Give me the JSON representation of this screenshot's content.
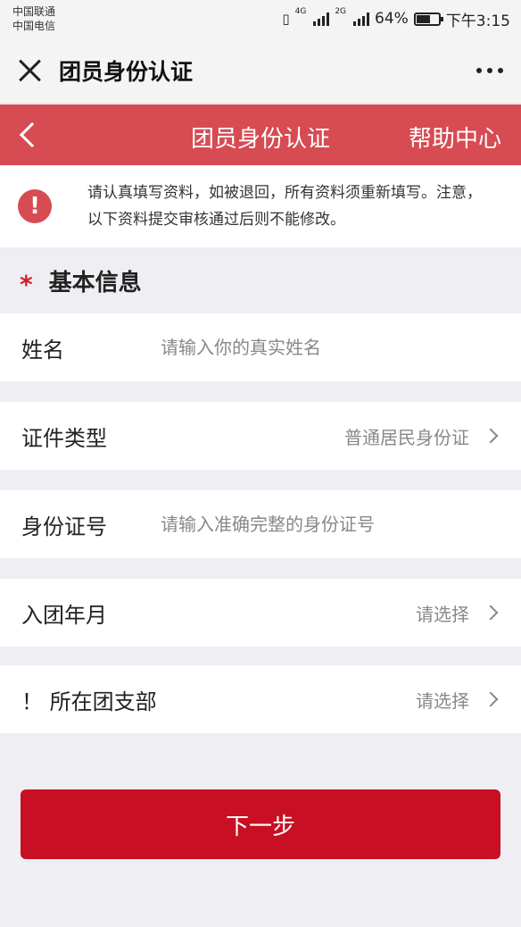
{
  "status_bar": {
    "carrier1": "中国联通",
    "carrier2": "中国电信",
    "net1": "4G",
    "net2": "2G",
    "battery_percent": "64%",
    "battery_level": 0.64,
    "time": "下午3:15"
  },
  "wx_bar": {
    "title": "团员身份认证"
  },
  "header": {
    "title": "团员身份认证",
    "help": "帮助中心"
  },
  "notice": {
    "text": "请认真填写资料，如被退回，所有资料须重新填写。注意，以下资料提交审核通过后则不能修改。"
  },
  "section": {
    "asterisk": "*",
    "title": "基本信息"
  },
  "form": {
    "name_label": "姓名",
    "name_placeholder": "请输入你的真实姓名",
    "id_type_label": "证件类型",
    "id_type_value": "普通居民身份证",
    "id_number_label": "身份证号",
    "id_number_placeholder": "请输入准确完整的身份证号",
    "join_date_label": "入团年月",
    "join_date_value": "请选择",
    "branch_label": "！ 所在团支部",
    "branch_value": "请选择"
  },
  "next_button": "下一步",
  "colors": {
    "header_red": "#d74b53",
    "button_red": "#c80f23"
  }
}
